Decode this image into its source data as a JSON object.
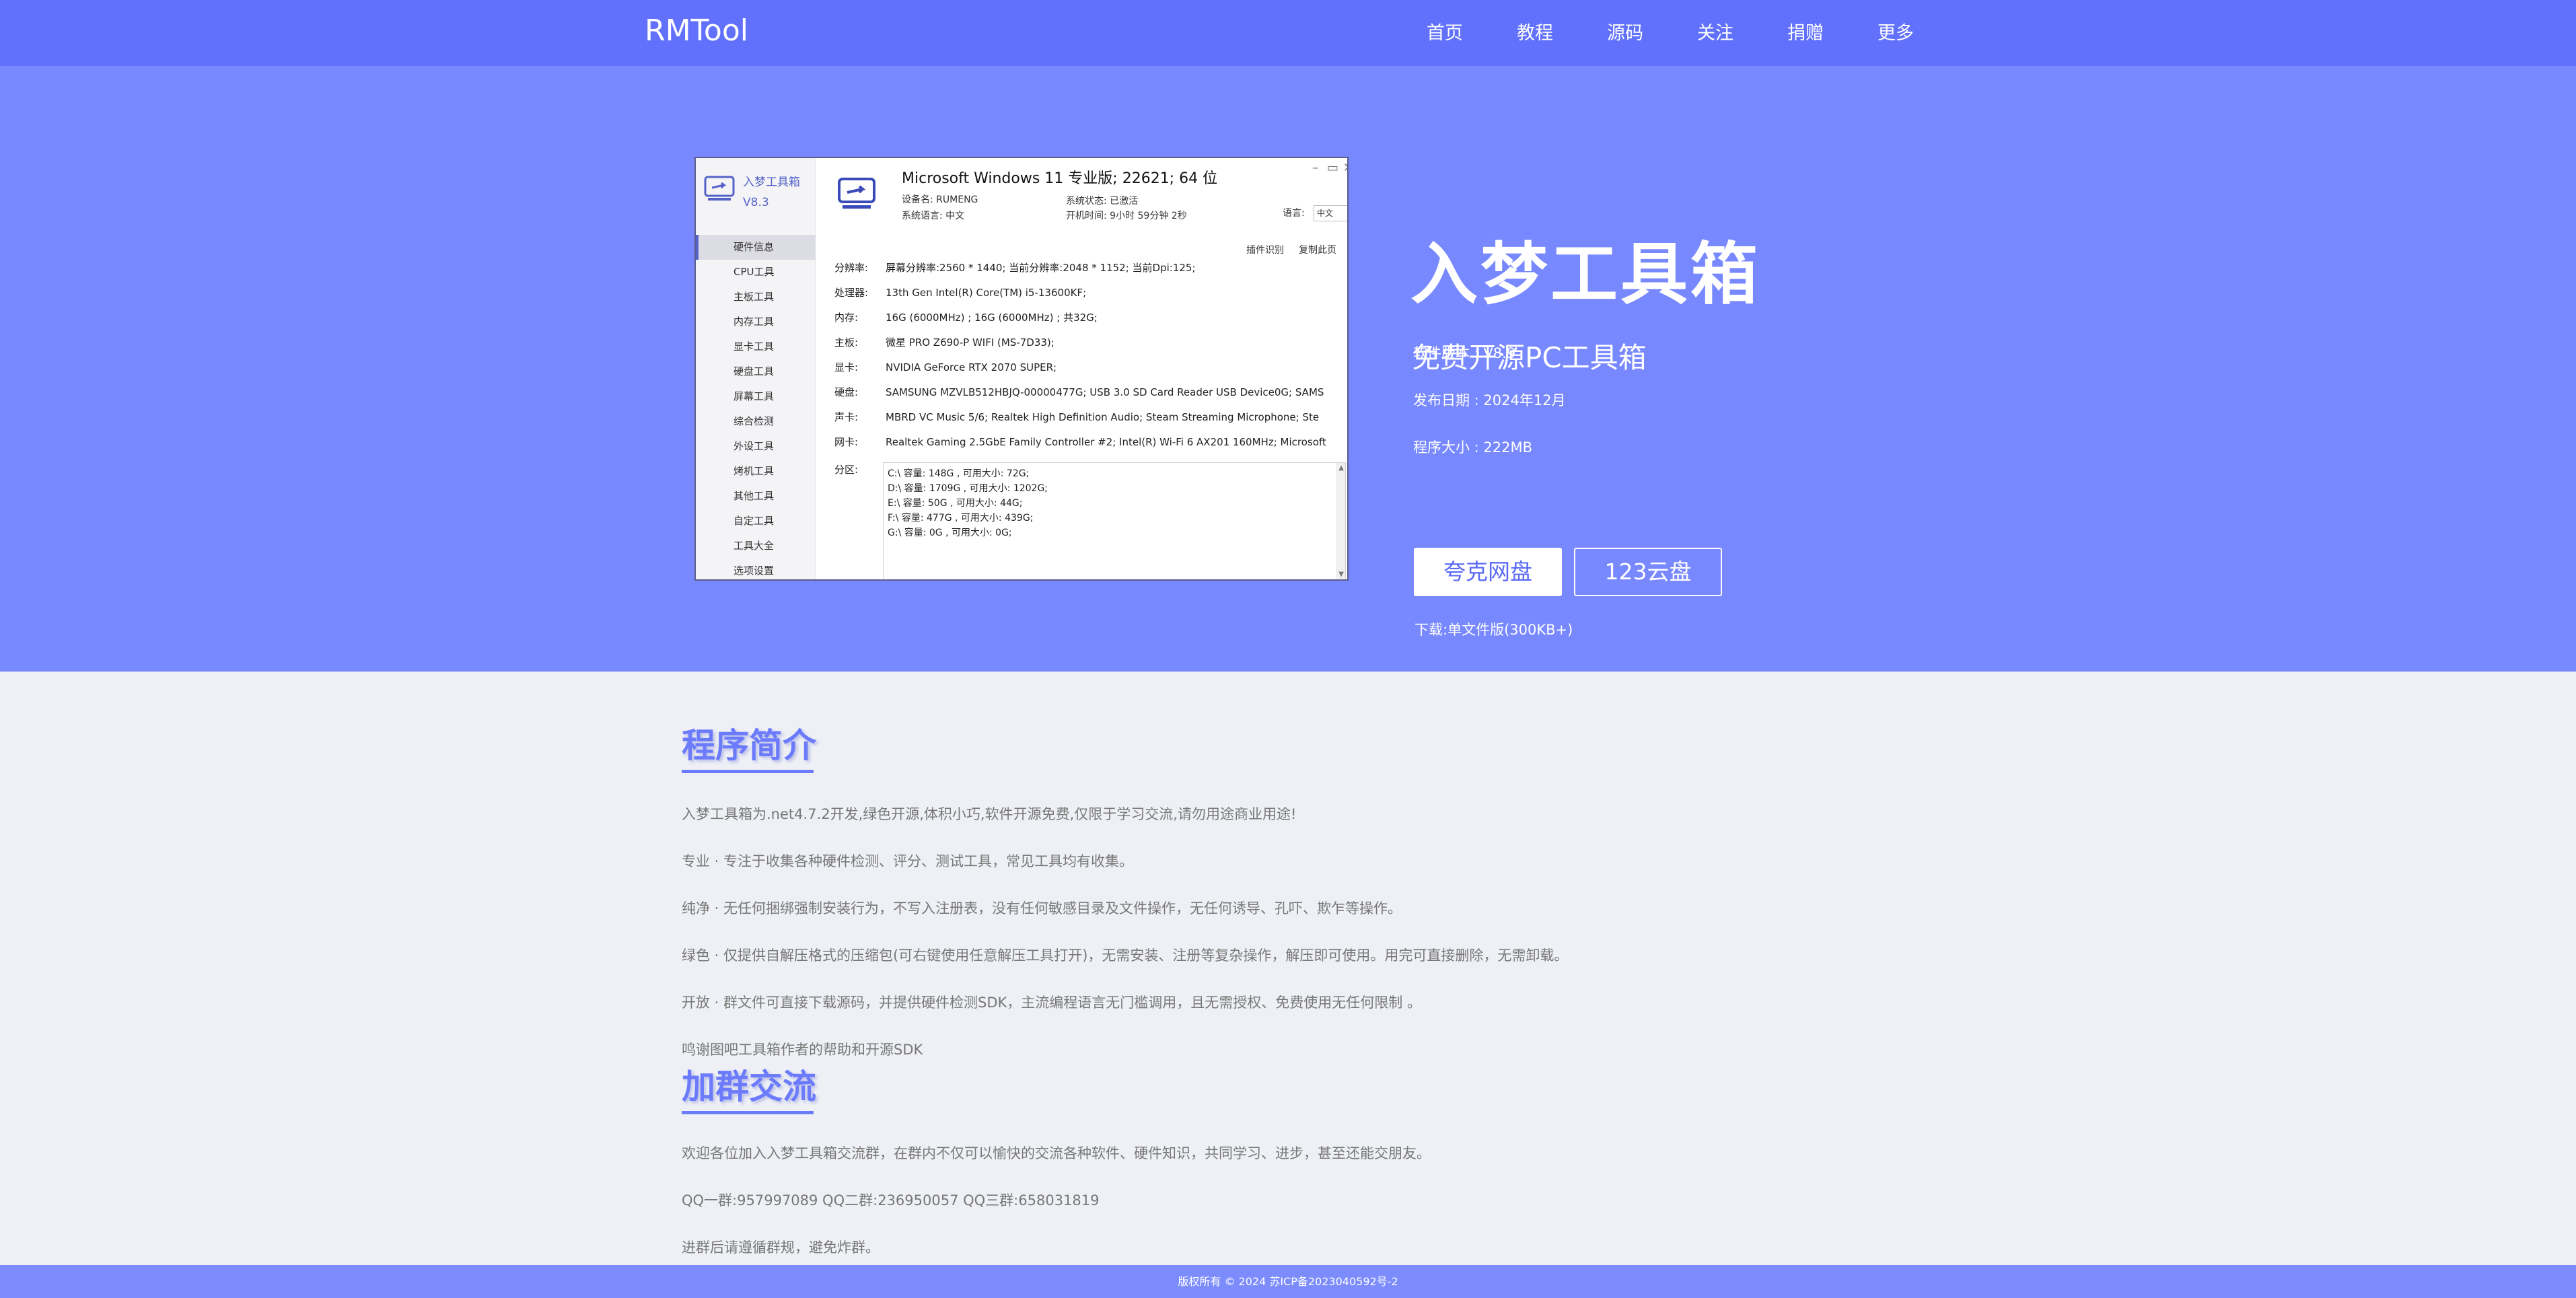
{
  "header": {
    "brand": "RMTool",
    "nav": [
      "首页",
      "教程",
      "源码",
      "关注",
      "捐赠",
      "更多"
    ]
  },
  "app_screenshot": {
    "sidebar": {
      "name": "入梦工具箱",
      "version": "V8.3",
      "items": [
        "硬件信息",
        "CPU工具",
        "主板工具",
        "内存工具",
        "显卡工具",
        "硬盘工具",
        "屏幕工具",
        "综合检测",
        "外设工具",
        "烤机工具",
        "其他工具",
        "自定工具",
        "工具大全",
        "选项设置"
      ]
    },
    "os_title": "Microsoft Windows 11 专业版; 22621; 64 位",
    "device_name": "设备名: RUMENG",
    "system_lang": "系统语言: 中文",
    "activation": "系统状态: 已激活",
    "uptime": "开机时间: 9小时 59分钟 2秒",
    "language_label": "语言:",
    "language_value": "中文",
    "plugin_link": "插件识别",
    "copy_link": "复制此页",
    "specs": [
      {
        "label": "分辨率:",
        "value": "屏幕分辨率:2560 * 1440;  当前分辨率:2048 * 1152;  当前Dpi:125;"
      },
      {
        "label": "处理器:",
        "value": "13th Gen Intel(R) Core(TM) i5-13600KF;"
      },
      {
        "label": "内存:",
        "value": "16G (6000MHz) ; 16G (6000MHz) ; 共32G;"
      },
      {
        "label": "主板:",
        "value": "微星 PRO Z690-P WIFI (MS-7D33);"
      },
      {
        "label": "显卡:",
        "value": "NVIDIA GeForce RTX 2070 SUPER;"
      },
      {
        "label": "硬盘:",
        "value": "SAMSUNG MZVLB512HBJQ-00000477G; USB 3.0  SD Card Reader USB Device0G; SAMS"
      },
      {
        "label": "声卡:",
        "value": "MBRD VC Music 5/6; Realtek High Definition Audio; Steam Streaming Microphone; Ste"
      },
      {
        "label": "网卡:",
        "value": "Realtek Gaming 2.5GbE Family Controller #2; Intel(R) Wi-Fi 6 AX201 160MHz; Microsoft"
      }
    ],
    "partition_label": "分区:",
    "partitions": [
      "C:\\ 容量: 148G , 可用大小: 72G;",
      "D:\\ 容量: 1709G , 可用大小: 1202G;",
      "E:\\ 容量: 50G , 可用大小: 44G;",
      "F:\\ 容量: 477G , 可用大小: 439G;",
      "G:\\ 容量: 0G , 可用大小: 0G;"
    ]
  },
  "hero": {
    "title": "入梦工具箱",
    "subtitle": "免费开源PC工具箱",
    "version": "软件版本 : V8.9",
    "release_date": "发布日期 : 2024年12月",
    "size": "程序大小 : 222MB",
    "btn_quark": "夸克网盘",
    "btn_123": "123云盘",
    "download_note": "下载:单文件版(300KB+)"
  },
  "intro": {
    "title": "程序简介",
    "paragraphs": [
      "入梦工具箱为.net4.7.2开发,绿色开源,体积小巧,软件开源免费,仅限于学习交流,请勿用途商业用途!",
      "专业 · 专注于收集各种硬件检测、评分、测试工具，常见工具均有收集。",
      "纯净 · 无任何捆绑强制安装行为，不写入注册表，没有任何敏感目录及文件操作，无任何诱导、孔吓、欺乍等操作。",
      "绿色 · 仅提供自解压格式的压缩包(可右键使用任意解压工具打开)，无需安装、注册等复杂操作，解压即可使用。用完可直接删除，无需卸载。",
      "开放 · 群文件可直接下载源码，并提供硬件检测SDK，主流编程语言无门槛调用，且无需授权、免费使用无任何限制 。",
      "鸣谢图吧工具箱作者的帮助和开源SDK"
    ]
  },
  "group": {
    "title": "加群交流",
    "paragraphs": [
      "欢迎各位加入入梦工具箱交流群，在群内不仅可以愉快的交流各种软件、硬件知识，共同学习、进步，甚至还能交朋友。",
      "QQ一群:957997089 QQ二群:236950057 QQ三群:658031819",
      "进群后请遵循群规，避免炸群。"
    ]
  },
  "footer": {
    "text": "版权所有 © 2024 苏ICP备2023040592号-2"
  },
  "colors": {
    "nav_bg": "#6271fb",
    "hero_bg": "#7888fe",
    "accent": "#6b7bfb",
    "page_bg": "#eef0f5",
    "footer_bg": "#7c8cfd"
  }
}
